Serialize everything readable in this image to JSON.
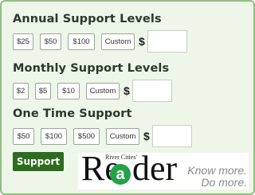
{
  "annual": {
    "heading": "Annual Support Levels",
    "options": [
      "$25",
      "$50",
      "$100",
      "Custom"
    ],
    "currency": "$",
    "custom_value": ""
  },
  "monthly": {
    "heading": "Monthly Support Levels",
    "options": [
      "$2",
      "$5",
      "$10",
      "Custom"
    ],
    "currency": "$",
    "custom_value": ""
  },
  "onetime": {
    "heading": "One Time Support",
    "options": [
      "$50",
      "$100",
      "$500",
      "Custom"
    ],
    "currency": "$",
    "custom_value": ""
  },
  "submit_label": "Support",
  "ad": {
    "logo_small": "River Cities'",
    "logo_r": "Re",
    "logo_at": "a",
    "logo_der": "der",
    "tagline_line1": "Know more.",
    "tagline_line2": "Do more."
  },
  "colors": {
    "panel_bg": "#eef5e9",
    "panel_border": "#8fbf7f",
    "button_green": "#2e6b1f",
    "logo_green": "#23a24a"
  }
}
